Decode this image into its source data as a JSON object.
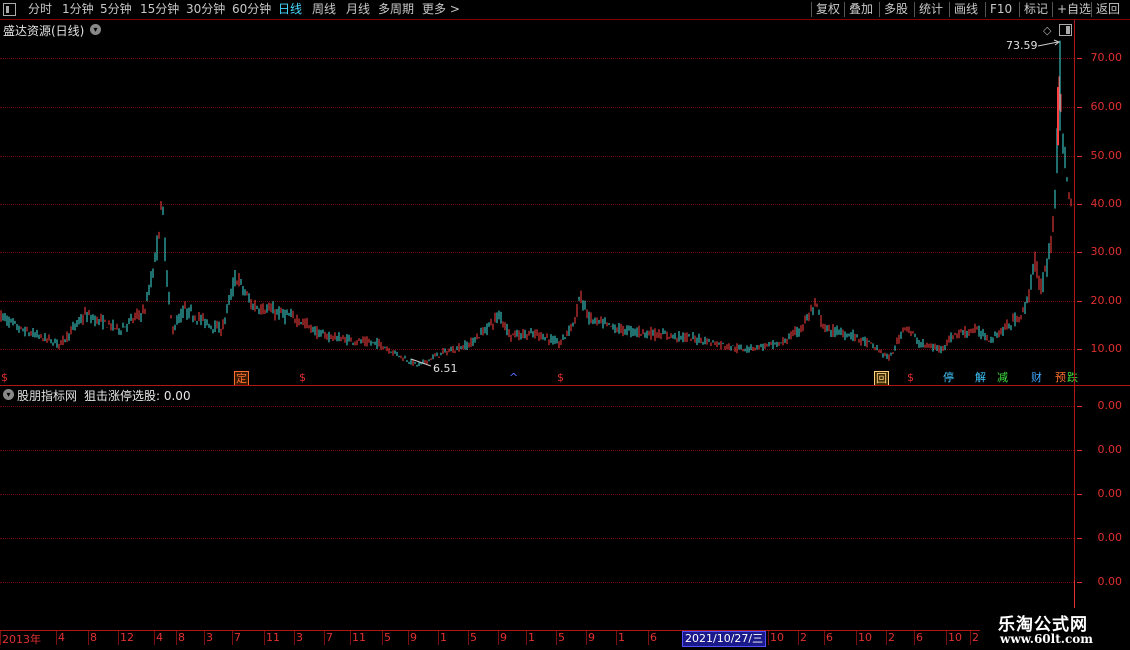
{
  "toolbar": {
    "left": [
      {
        "label": "分时",
        "active": false
      },
      {
        "label": "1分钟",
        "active": false
      },
      {
        "label": "5分钟",
        "active": false
      },
      {
        "label": "15分钟",
        "active": false
      },
      {
        "label": "30分钟",
        "active": false
      },
      {
        "label": "60分钟",
        "active": false
      },
      {
        "label": "日线",
        "active": true
      },
      {
        "label": "周线",
        "active": false
      },
      {
        "label": "月线",
        "active": false
      },
      {
        "label": "多周期",
        "active": false
      },
      {
        "label": "更多 >",
        "active": false
      }
    ],
    "right": [
      "复权",
      "叠加",
      "多股",
      "统计",
      "画线",
      "F10",
      "标记",
      "+自选",
      "返回"
    ]
  },
  "main_chart": {
    "title": "盛达资源(日线)",
    "high_label": "73.59",
    "low_label": "6.51",
    "y_ticks": [
      "70.00",
      "60.00",
      "50.00",
      "40.00",
      "30.00",
      "20.00",
      "10.00"
    ],
    "events": [
      {
        "text": "$",
        "color": "#e03030",
        "bg": "none"
      },
      {
        "text": "定",
        "color": "#ff7030",
        "bg": "#3a1a00"
      },
      {
        "text": "$",
        "color": "#e03030",
        "bg": "none"
      },
      {
        "text": "^",
        "color": "#5070ff",
        "bg": "none"
      },
      {
        "text": "$",
        "color": "#e03030",
        "bg": "none"
      },
      {
        "text": "回",
        "color": "#ffd080",
        "bg": "#3a2a00"
      },
      {
        "text": "$",
        "color": "#e03030",
        "bg": "none"
      },
      {
        "text": "停",
        "color": "#40c8ff",
        "bg": "none"
      },
      {
        "text": "解",
        "color": "#40c8ff",
        "bg": "none"
      },
      {
        "text": "减",
        "color": "#40e040",
        "bg": "none"
      },
      {
        "text": "财",
        "color": "#40a8ff",
        "bg": "none"
      },
      {
        "text": "预",
        "color": "#ff7030",
        "bg": "none"
      },
      {
        "text": "跌",
        "color": "#40e040",
        "bg": "none"
      }
    ]
  },
  "indicator": {
    "title": "股朋指标网",
    "series_label": "狙击涨停选股: 0.00",
    "y_ticks": [
      "0.00",
      "0.00",
      "0.00",
      "0.00",
      "0.00"
    ]
  },
  "x_axis": {
    "labels": [
      "2013年",
      "4",
      "8",
      "12",
      "4",
      "8",
      "3",
      "7",
      "11",
      "3",
      "7",
      "11",
      "5",
      "9",
      "1",
      "5",
      "9",
      "1",
      "5",
      "9",
      "1",
      "6",
      "10",
      "2",
      "6",
      "10",
      "2",
      "6",
      "10",
      "2"
    ],
    "cursor_date": "2021/10/27/三"
  },
  "watermark": {
    "line1": "乐淘公式网",
    "line2": "www.60lt.com"
  },
  "colors": {
    "up": "#ff4040",
    "down": "#40e0e0",
    "axis": "#e03030",
    "grid": "#6a0a0a"
  }
}
